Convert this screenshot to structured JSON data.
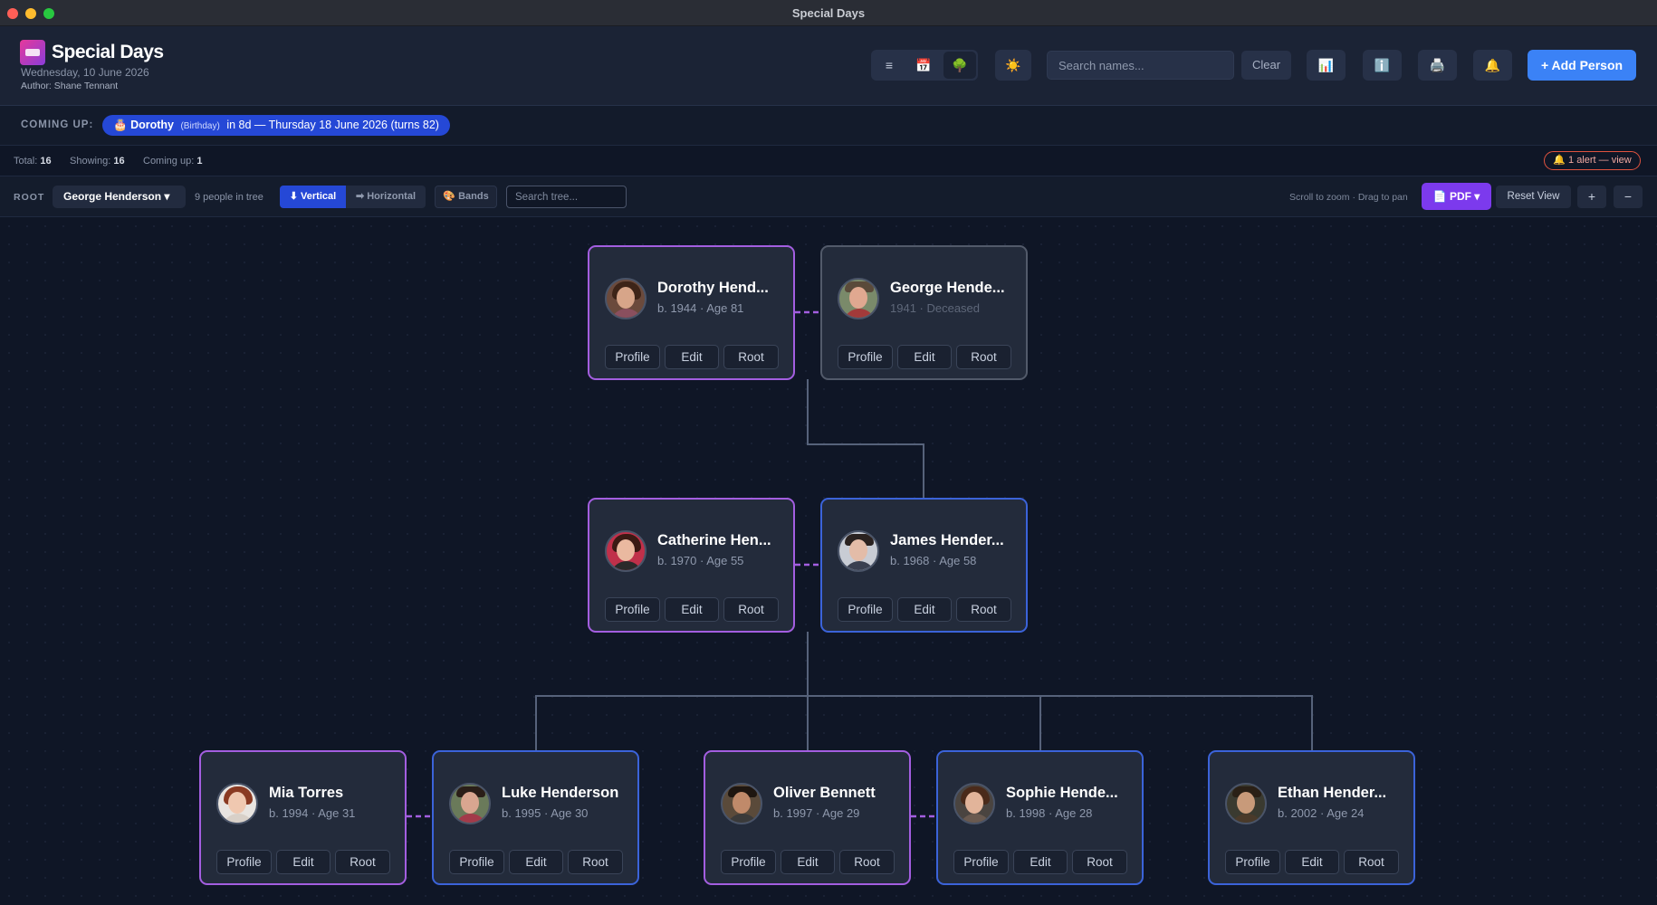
{
  "window": {
    "title": "Special Days"
  },
  "header": {
    "app_title": "Special Days",
    "date": "Wednesday, 10 June 2026",
    "author": "Author: Shane Tennant",
    "view_buttons": [
      "≡",
      "📅",
      "🌳"
    ],
    "theme_icon": "☀️",
    "search_placeholder": "Search names...",
    "clear_label": "Clear",
    "stats_icon": "📊",
    "info_icon": "ℹ️",
    "print_icon": "🖨️",
    "notify_icon": "🔔",
    "add_label": "+ Add Person"
  },
  "coming_up": {
    "label": "COMING UP:",
    "icon": "🎂",
    "name": "Dorothy",
    "event": "(Birthday)",
    "detail": "in 8d — Thursday 18 June 2026 (turns 82)"
  },
  "stats": {
    "total_label": "Total:",
    "total": "16",
    "showing_label": "Showing:",
    "showing": "16",
    "coming_label": "Coming up:",
    "coming": "1",
    "alert": "🔔 1 alert — view"
  },
  "tree_toolbar": {
    "root_label": "ROOT",
    "root_value": "George Henderson ▾",
    "people_count": "9 people in tree",
    "vertical_label": "⬇ Vertical",
    "horizontal_label": "➡ Horizontal",
    "bands_label": "🎨 Bands",
    "search_placeholder": "Search tree...",
    "hint": "Scroll to zoom · Drag to pan",
    "pdf_label": "📄 PDF ▾",
    "reset_label": "Reset View",
    "zoom_in": "+",
    "zoom_out": "−"
  },
  "card_buttons": {
    "profile": "Profile",
    "edit": "Edit",
    "root": "Root"
  },
  "people": [
    {
      "name": "Dorothy Hend...",
      "meta": "b. 1944 · Age 81"
    },
    {
      "name": "George Hende...",
      "meta": "1941 · Deceased"
    },
    {
      "name": "Catherine Hen...",
      "meta": "b. 1970 · Age 55"
    },
    {
      "name": "James Hender...",
      "meta": "b. 1968 · Age 58"
    },
    {
      "name": "Mia Torres",
      "meta": "b. 1994 · Age 31"
    },
    {
      "name": "Luke Henderson",
      "meta": "b. 1995 · Age 30"
    },
    {
      "name": "Oliver Bennett",
      "meta": "b. 1997 · Age 29"
    },
    {
      "name": "Sophie Hende...",
      "meta": "b. 1998 · Age 28"
    },
    {
      "name": "Ethan Hender...",
      "meta": "b. 2002 · Age 24"
    }
  ],
  "colors": {
    "female_border": "#a35ee0",
    "male_border": "#3b63d9",
    "deceased_border": "#525a6a",
    "accent": "#3b82f6",
    "pdf": "#7c3aed",
    "spouse_line": "#a35ee0"
  }
}
